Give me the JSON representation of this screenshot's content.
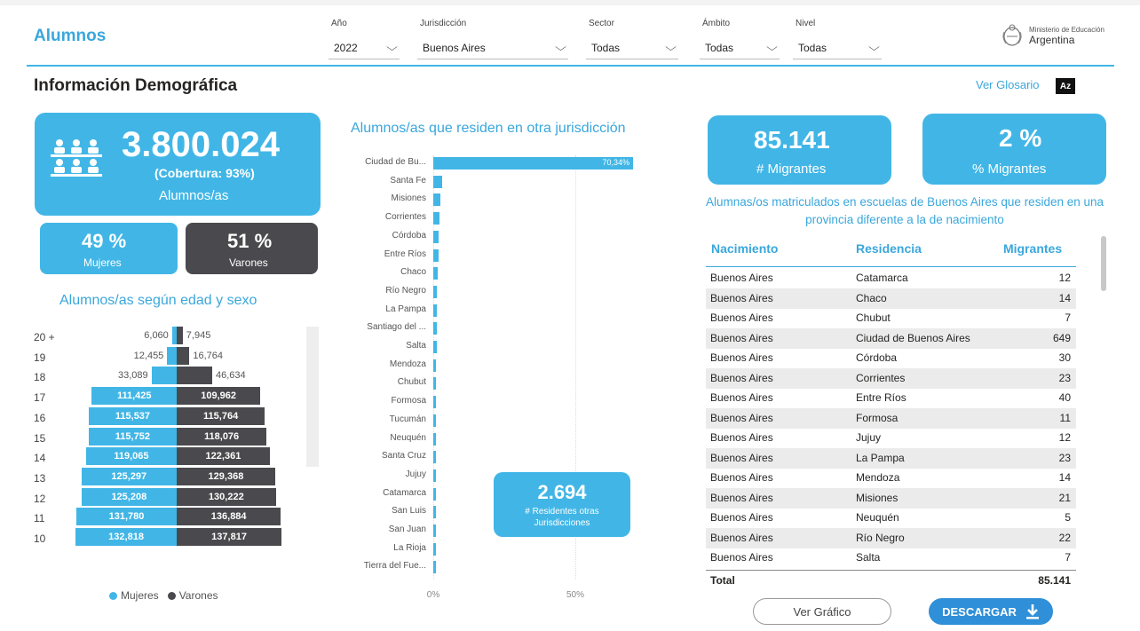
{
  "header": {
    "app_title": "Alumnos",
    "filters": [
      {
        "label": "Año",
        "value": "2022"
      },
      {
        "label": "Jurisdicción",
        "value": "Buenos Aires"
      },
      {
        "label": "Sector",
        "value": "Todas"
      },
      {
        "label": "Ámbito",
        "value": "Todas"
      },
      {
        "label": "Nivel",
        "value": "Todas"
      }
    ],
    "ministry_line1": "Ministerio de Educación",
    "ministry_line2": "Argentina",
    "ministry_icon": "coat-of-arms-icon"
  },
  "section_title": "Información Demográfica",
  "glosario": {
    "label": "Ver Glosario",
    "icon_text": "Az"
  },
  "kpi_main": {
    "value": "3.800.024",
    "coverage": "(Cobertura: 93%)",
    "label": "Alumnos/as",
    "icon": "people-icon"
  },
  "kpi_women": {
    "value": "49 %",
    "label": "Mujeres"
  },
  "kpi_men": {
    "value": "51 %",
    "label": "Varones"
  },
  "pyramid": {
    "title": "Alumnos/as según edad y sexo",
    "rows": [
      {
        "age": "20 +",
        "f": "6,060",
        "m": "7,945",
        "fv": 6060,
        "mv": 7945
      },
      {
        "age": "19",
        "f": "12,455",
        "m": "16,764",
        "fv": 12455,
        "mv": 16764
      },
      {
        "age": "18",
        "f": "33,089",
        "m": "46,634",
        "fv": 33089,
        "mv": 46634
      },
      {
        "age": "17",
        "f": "111,425",
        "m": "109,962",
        "fv": 111425,
        "mv": 109962
      },
      {
        "age": "16",
        "f": "115,537",
        "m": "115,764",
        "fv": 115537,
        "mv": 115764
      },
      {
        "age": "15",
        "f": "115,752",
        "m": "118,076",
        "fv": 115752,
        "mv": 118076
      },
      {
        "age": "14",
        "f": "119,065",
        "m": "122,361",
        "fv": 119065,
        "mv": 122361
      },
      {
        "age": "13",
        "f": "125,297",
        "m": "129,368",
        "fv": 125297,
        "mv": 129368
      },
      {
        "age": "12",
        "f": "125,208",
        "m": "130,222",
        "fv": 125208,
        "mv": 130222
      },
      {
        "age": "11",
        "f": "131,780",
        "m": "136,884",
        "fv": 131780,
        "mv": 136884
      },
      {
        "age": "10",
        "f": "132,818",
        "m": "137,817",
        "fv": 132818,
        "mv": 137817
      }
    ],
    "legend_women": "Mujeres",
    "legend_men": "Varones",
    "color_women": "#41b6e6",
    "color_men": "#4a4a4e"
  },
  "chart_data": {
    "type": "bar",
    "title": "Alumnos/as que residen en otra jurisdicción",
    "categories": [
      "Ciudad de Bu...",
      "Santa Fe",
      "Misiones",
      "Corrientes",
      "Córdoba",
      "Entre Ríos",
      "Chaco",
      "Río Negro",
      "La Pampa",
      "Santiago del ...",
      "Salta",
      "Mendoza",
      "Chubut",
      "Formosa",
      "Tucumán",
      "Neuquén",
      "Santa Cruz",
      "Jujuy",
      "Catamarca",
      "San Luis",
      "San Juan",
      "La Rioja",
      "Tierra del Fue..."
    ],
    "values": [
      70.34,
      3.2,
      2.6,
      2.2,
      2.0,
      1.8,
      1.5,
      1.4,
      1.3,
      1.2,
      1.1,
      1.0,
      0.9,
      0.9,
      0.8,
      0.7,
      0.6,
      0.6,
      0.5,
      0.4,
      0.35,
      0.3,
      0.2
    ],
    "data_label": "70,34%",
    "xticks": [
      "0%",
      "50%"
    ],
    "xlim": [
      0,
      100
    ]
  },
  "residents_card": {
    "value": "2.694",
    "label": "# Residentes otras Jurisdicciones"
  },
  "kpi_migrants": {
    "value": "85.141",
    "label": "# Migrantes"
  },
  "kpi_migrants_pct": {
    "value": "2 %",
    "label": "% Migrantes"
  },
  "migrants_desc": "Alumnas/os matriculados en escuelas de Buenos Aires que residen en una provincia diferente a la de nacimiento",
  "table": {
    "headers": [
      "Nacimiento",
      "Residencia",
      "Migrantes"
    ],
    "rows": [
      [
        "Buenos Aires",
        "Catamarca",
        "12"
      ],
      [
        "Buenos Aires",
        "Chaco",
        "14"
      ],
      [
        "Buenos Aires",
        "Chubut",
        "7"
      ],
      [
        "Buenos Aires",
        "Ciudad de Buenos Aires",
        "649"
      ],
      [
        "Buenos Aires",
        "Córdoba",
        "30"
      ],
      [
        "Buenos Aires",
        "Corrientes",
        "23"
      ],
      [
        "Buenos Aires",
        "Entre Ríos",
        "40"
      ],
      [
        "Buenos Aires",
        "Formosa",
        "11"
      ],
      [
        "Buenos Aires",
        "Jujuy",
        "12"
      ],
      [
        "Buenos Aires",
        "La Pampa",
        "23"
      ],
      [
        "Buenos Aires",
        "Mendoza",
        "14"
      ],
      [
        "Buenos Aires",
        "Misiones",
        "21"
      ],
      [
        "Buenos Aires",
        "Neuquén",
        "5"
      ],
      [
        "Buenos Aires",
        "Río Negro",
        "22"
      ],
      [
        "Buenos Aires",
        "Salta",
        "7"
      ]
    ],
    "total_label": "Total",
    "total_value": "85.141"
  },
  "buttons": {
    "ver_grafico": "Ver Gráfico",
    "descargar": "DESCARGAR",
    "download_icon": "download-arrow-icon"
  }
}
